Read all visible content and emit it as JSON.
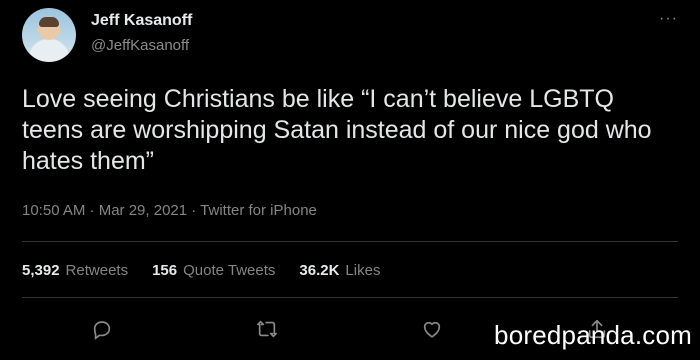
{
  "tweet": {
    "author_name": "Jeff Kasanoff",
    "author_handle": "@JeffKasanoff",
    "more_label": "···",
    "text": "Love seeing Christians be like “I can’t believe LGBTQ teens are worshipping Satan instead of our nice god who hates them”",
    "meta": "10:50 AM · Mar 29, 2021 · Twitter for iPhone",
    "stats": {
      "retweets_count": "5,392",
      "retweets_label": "Retweets",
      "quotes_count": "156",
      "quotes_label": "Quote Tweets",
      "likes_count": "36.2K",
      "likes_label": "Likes"
    },
    "actions": {
      "reply_icon": "reply-icon",
      "retweet_icon": "retweet-icon",
      "like_icon": "heart-icon",
      "share_icon": "share-icon"
    }
  },
  "watermark": "boredpanda.com",
  "colors": {
    "background": "#000000",
    "text": "#e4e6e7",
    "muted": "#858585",
    "divider": "#2f3336"
  }
}
